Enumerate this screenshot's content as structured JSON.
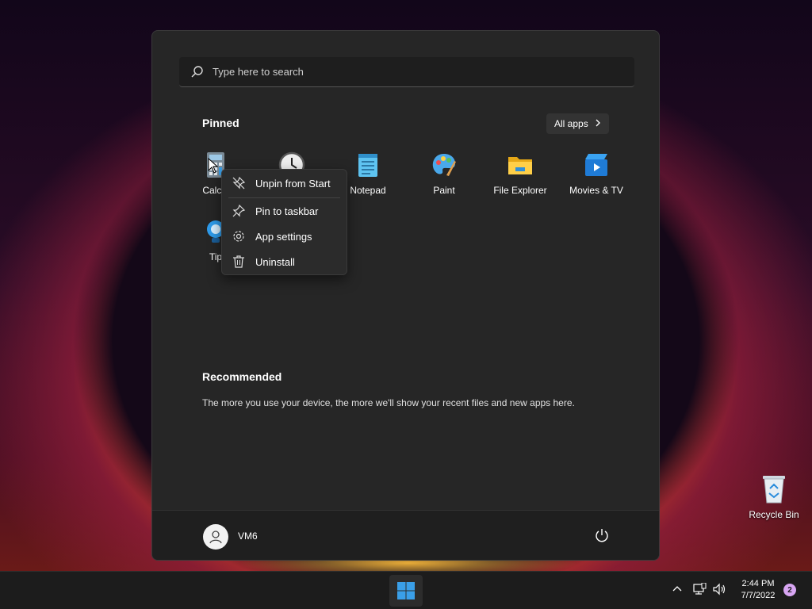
{
  "search": {
    "placeholder": "Type here to search"
  },
  "pinned": {
    "title": "Pinned",
    "all_apps_label": "All apps",
    "apps": [
      {
        "label": "Calcul",
        "icon": "calculator-icon"
      },
      {
        "label": "",
        "icon": "clock-icon"
      },
      {
        "label": "Notepad",
        "icon": "notepad-icon"
      },
      {
        "label": "Paint",
        "icon": "paint-icon"
      },
      {
        "label": "File Explorer",
        "icon": "folder-icon"
      },
      {
        "label": "Movies & TV",
        "icon": "movies-icon"
      },
      {
        "label": "Tip",
        "icon": "tips-lightbulb-icon"
      }
    ]
  },
  "context_menu": {
    "items": [
      {
        "label": "Unpin from Start",
        "icon": "unpin-icon"
      },
      {
        "label": "Pin to taskbar",
        "icon": "pin-icon"
      },
      {
        "label": "App settings",
        "icon": "gear-icon"
      },
      {
        "label": "Uninstall",
        "icon": "trash-icon"
      }
    ]
  },
  "recommended": {
    "title": "Recommended",
    "message": "The more you use your device, the more we'll show your recent files and new apps here."
  },
  "user": {
    "name": "VM6"
  },
  "desktop": {
    "recycle_bin_label": "Recycle Bin"
  },
  "taskbar": {
    "time": "2:44 PM",
    "date": "7/7/2022",
    "notification_count": "2"
  },
  "colors": {
    "accent": "#3a9fe8",
    "menu_bg": "#262626",
    "notif_badge": "#d8a6f3"
  }
}
